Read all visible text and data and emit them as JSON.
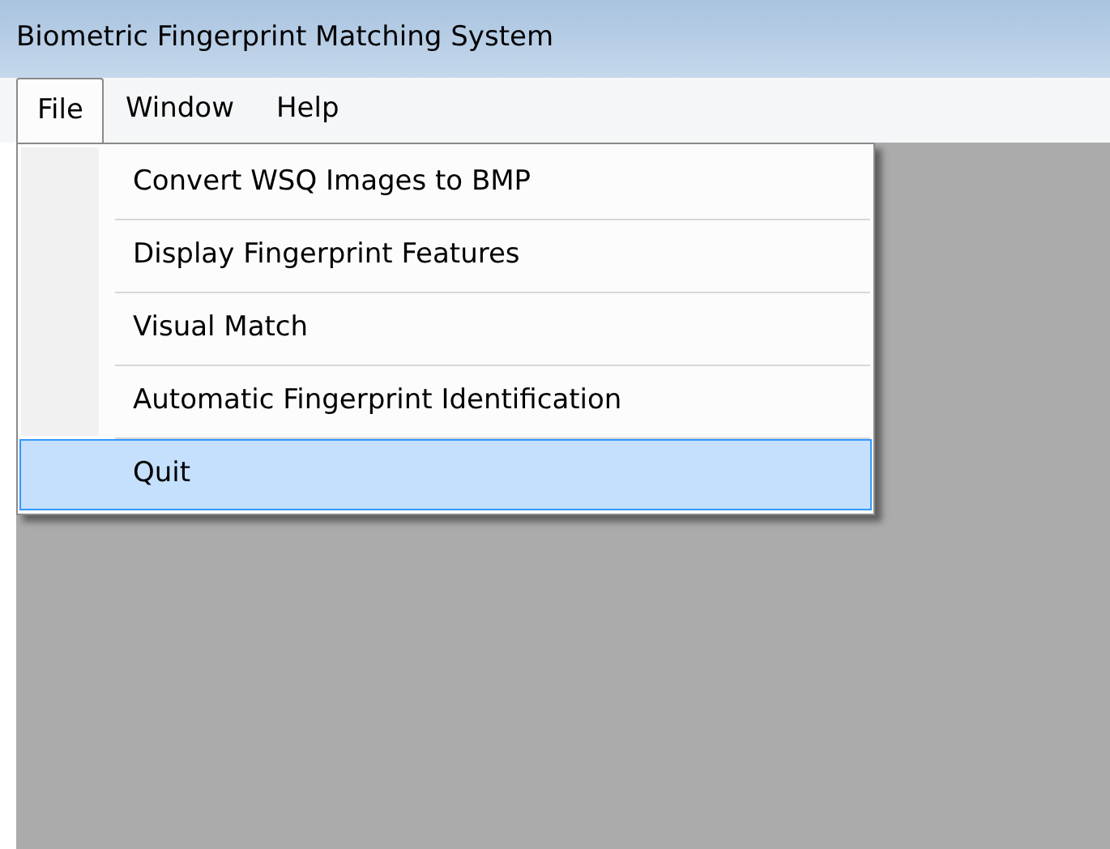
{
  "window": {
    "title": "Biometric Fingerprint Matching System"
  },
  "menu_bar": [
    {
      "label": "File",
      "selected": true
    },
    {
      "label": "Window",
      "selected": false
    },
    {
      "label": "Help",
      "selected": false
    }
  ],
  "dropdown": [
    {
      "label": "Convert WSQ Images to BMP",
      "selected": false
    },
    {
      "label": "Display Fingerprint Features",
      "selected": false
    },
    {
      "label": "Visual Match",
      "selected": false
    },
    {
      "label": "Automatic Fingerprint Identification",
      "selected": false
    },
    {
      "label": "Quit",
      "selected": true
    }
  ]
}
